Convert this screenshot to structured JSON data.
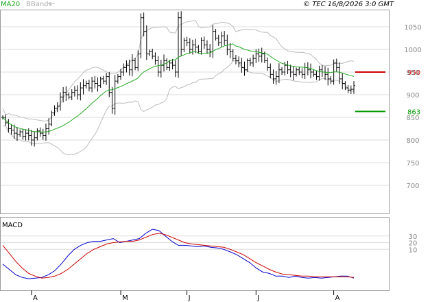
{
  "header": {
    "copyright": "© TEC 16/8/2026 3:0 GMT",
    "legend_ma20": "MA20",
    "legend_bbands": "BBands",
    "macd_label": "MACD"
  },
  "colors": {
    "ma20": "#22aa22",
    "bbands": "#bbbbbb",
    "price": "#000000",
    "macd_line": "#0000cc",
    "signal_line": "#cc0000",
    "resistance": "#cc0000",
    "support": "#009900",
    "grid": "#dddddd"
  },
  "chart_data": [
    {
      "type": "ohlc",
      "panel": "price",
      "ylim": [
        650,
        1100
      ],
      "y_ticks": [
        "1050",
        "1000",
        "950",
        "900",
        "850",
        "800",
        "750",
        "700"
      ],
      "x_month_labels": [
        "A",
        "M",
        "J",
        "J",
        "A"
      ],
      "levels": [
        {
          "label": "950",
          "value": 950,
          "role": "resistance"
        },
        {
          "label": "863",
          "value": 863,
          "role": "support"
        }
      ],
      "series": [
        {
          "name": "MA20",
          "role": "ma20"
        },
        {
          "name": "BBands",
          "role": "bbands"
        }
      ],
      "close": [
        850,
        838,
        825,
        822,
        815,
        812,
        818,
        808,
        815,
        810,
        800,
        805,
        820,
        815,
        810,
        825,
        835,
        860,
        870,
        875,
        895,
        905,
        900,
        895,
        905,
        910,
        900,
        915,
        920,
        925,
        915,
        930,
        925,
        920,
        935,
        930,
        940,
        905,
        870,
        930,
        940,
        950,
        960,
        965,
        955,
        975,
        960,
        990,
        1070,
        1040,
        990,
        995,
        985,
        975,
        950,
        965,
        975,
        960,
        970,
        965,
        950,
        1070,
        1000,
        1020,
        1015,
        1000,
        1010,
        1005,
        995,
        1020,
        1010,
        1000,
        995,
        1040,
        1025,
        1015,
        1030,
        1020,
        1000,
        995,
        980,
        975,
        970,
        960,
        955,
        975,
        970,
        980,
        990,
        985,
        990,
        975,
        960,
        945,
        935,
        940,
        955,
        950,
        965,
        955,
        950,
        945,
        955,
        950,
        945,
        960,
        955,
        950,
        945,
        940,
        955,
        950,
        945,
        935,
        930,
        970,
        960,
        935,
        925,
        915,
        910,
        912,
        920
      ]
    },
    {
      "type": "line",
      "panel": "macd",
      "y_ticks": [
        "30",
        "20",
        "10"
      ],
      "series": [
        {
          "name": "",
          "role": "macd",
          "values": [
            -12,
            -20,
            -28,
            -32,
            -34,
            -33,
            -32,
            -28,
            -22,
            -12,
            0,
            10,
            16,
            20,
            22,
            22,
            24,
            26,
            20,
            22,
            24,
            26,
            34,
            40,
            38,
            30,
            22,
            16,
            16,
            15,
            14,
            15,
            13,
            12,
            10,
            6,
            2,
            -4,
            -10,
            -18,
            -24,
            -26,
            -30,
            -30,
            -32,
            -30,
            -32,
            -33,
            -32,
            -33,
            -32,
            -31,
            -30,
            -30,
            -33
          ]
        },
        {
          "name": "",
          "role": "signal",
          "values": [
            16,
            4,
            -8,
            -18,
            -26,
            -30,
            -33,
            -32,
            -30,
            -26,
            -20,
            -12,
            -4,
            4,
            10,
            14,
            18,
            20,
            21,
            22,
            22,
            24,
            28,
            32,
            34,
            32,
            28,
            24,
            20,
            18,
            17,
            16,
            15,
            14,
            13,
            10,
            6,
            2,
            -4,
            -10,
            -15,
            -20,
            -24,
            -27,
            -28,
            -29,
            -30,
            -30,
            -31,
            -31,
            -31,
            -31,
            -31,
            -31,
            -32
          ]
        }
      ]
    }
  ]
}
